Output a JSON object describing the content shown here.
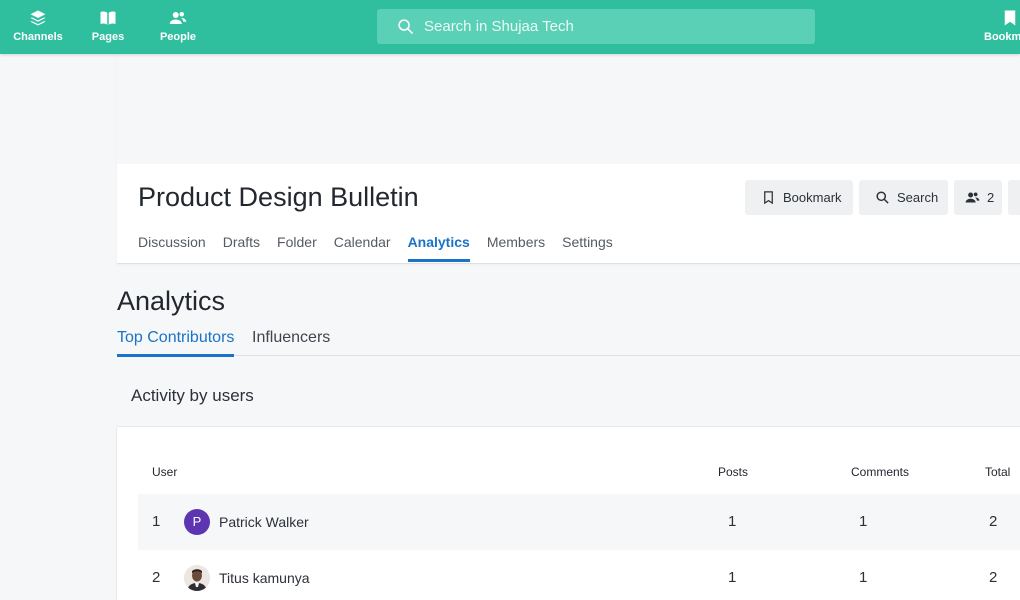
{
  "topnav": {
    "items": [
      {
        "label": "Channels",
        "icon": "layers-icon"
      },
      {
        "label": "Pages",
        "icon": "book-icon"
      },
      {
        "label": "People",
        "icon": "people-icon"
      }
    ],
    "bookmarks_label": "Bookm",
    "search_placeholder": "Search in Shujaa Tech"
  },
  "channel": {
    "title": "Product Design Bulletin",
    "buttons": {
      "bookmark": "Bookmark",
      "search": "Search",
      "members_count": "2"
    },
    "tabs": [
      {
        "label": "Discussion",
        "active": false
      },
      {
        "label": "Drafts",
        "active": false
      },
      {
        "label": "Folder",
        "active": false
      },
      {
        "label": "Calendar",
        "active": false
      },
      {
        "label": "Analytics",
        "active": true
      },
      {
        "label": "Members",
        "active": false
      },
      {
        "label": "Settings",
        "active": false
      }
    ]
  },
  "analytics": {
    "title": "Analytics",
    "subtabs": [
      {
        "label": "Top Contributors",
        "active": true
      },
      {
        "label": "Influencers",
        "active": false
      }
    ],
    "section_title": "Activity by users",
    "table": {
      "headers": {
        "user": "User",
        "posts": "Posts",
        "comments": "Comments",
        "total": "Total"
      },
      "rows": [
        {
          "rank": "1",
          "avatar_letter": "P",
          "name": "Patrick Walker",
          "posts": "1",
          "comments": "1",
          "total": "2"
        },
        {
          "rank": "2",
          "avatar_letter": "",
          "name": "Titus kamunya",
          "posts": "1",
          "comments": "1",
          "total": "2"
        }
      ]
    }
  },
  "colors": {
    "brand": "#2fbf9f",
    "accent": "#1a73c7",
    "avatar": "#5e35b1"
  }
}
